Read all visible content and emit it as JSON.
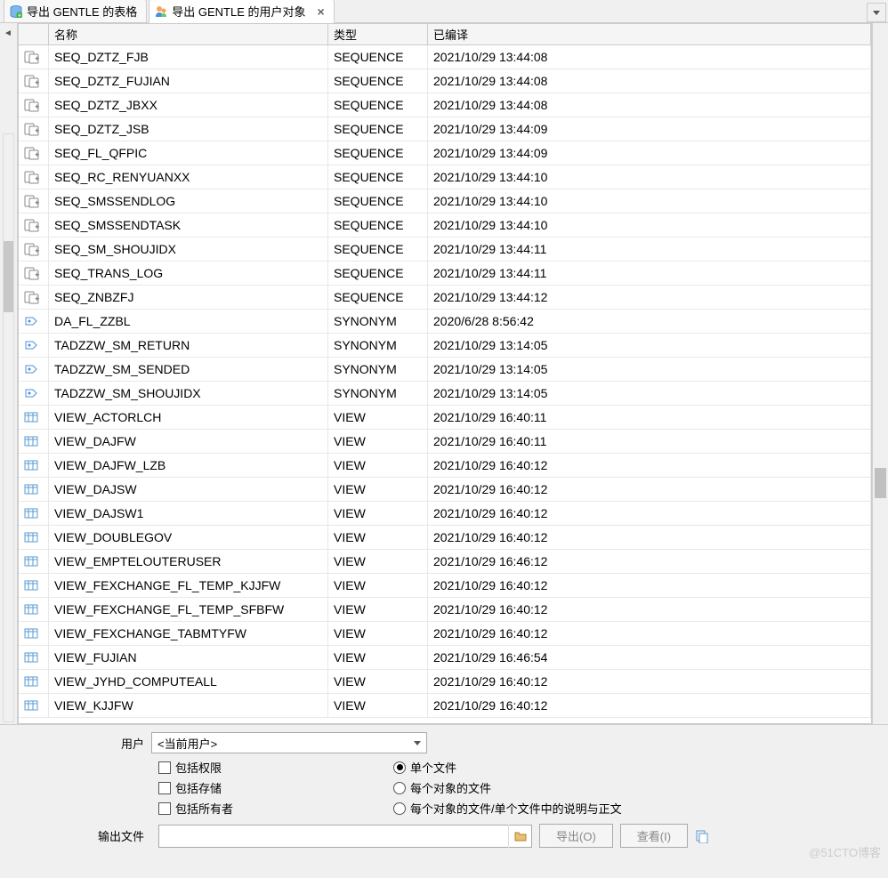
{
  "tabs": [
    {
      "label": "导出 GENTLE 的表格",
      "icon": "db"
    },
    {
      "label": "导出 GENTLE 的用户对象",
      "icon": "user",
      "active": true
    }
  ],
  "columns": {
    "name": "名称",
    "type": "类型",
    "compiled": "已编译"
  },
  "rows": [
    {
      "icon": "seq",
      "name": "SEQ_DZTZ_FJB",
      "type": "SEQUENCE",
      "compiled": "2021/10/29 13:44:08"
    },
    {
      "icon": "seq",
      "name": "SEQ_DZTZ_FUJIAN",
      "type": "SEQUENCE",
      "compiled": "2021/10/29 13:44:08"
    },
    {
      "icon": "seq",
      "name": "SEQ_DZTZ_JBXX",
      "type": "SEQUENCE",
      "compiled": "2021/10/29 13:44:08"
    },
    {
      "icon": "seq",
      "name": "SEQ_DZTZ_JSB",
      "type": "SEQUENCE",
      "compiled": "2021/10/29 13:44:09"
    },
    {
      "icon": "seq",
      "name": "SEQ_FL_QFPIC",
      "type": "SEQUENCE",
      "compiled": "2021/10/29 13:44:09"
    },
    {
      "icon": "seq",
      "name": "SEQ_RC_RENYUANXX",
      "type": "SEQUENCE",
      "compiled": "2021/10/29 13:44:10"
    },
    {
      "icon": "seq",
      "name": "SEQ_SMSSENDLOG",
      "type": "SEQUENCE",
      "compiled": "2021/10/29 13:44:10"
    },
    {
      "icon": "seq",
      "name": "SEQ_SMSSENDTASK",
      "type": "SEQUENCE",
      "compiled": "2021/10/29 13:44:10"
    },
    {
      "icon": "seq",
      "name": "SEQ_SM_SHOUJIDX",
      "type": "SEQUENCE",
      "compiled": "2021/10/29 13:44:11"
    },
    {
      "icon": "seq",
      "name": "SEQ_TRANS_LOG",
      "type": "SEQUENCE",
      "compiled": "2021/10/29 13:44:11"
    },
    {
      "icon": "seq",
      "name": "SEQ_ZNBZFJ",
      "type": "SEQUENCE",
      "compiled": "2021/10/29 13:44:12"
    },
    {
      "icon": "syn",
      "name": "DA_FL_ZZBL",
      "type": "SYNONYM",
      "compiled": "2020/6/28 8:56:42"
    },
    {
      "icon": "syn",
      "name": "TADZZW_SM_RETURN",
      "type": "SYNONYM",
      "compiled": "2021/10/29 13:14:05"
    },
    {
      "icon": "syn",
      "name": "TADZZW_SM_SENDED",
      "type": "SYNONYM",
      "compiled": "2021/10/29 13:14:05"
    },
    {
      "icon": "syn",
      "name": "TADZZW_SM_SHOUJIDX",
      "type": "SYNONYM",
      "compiled": "2021/10/29 13:14:05"
    },
    {
      "icon": "view",
      "name": "VIEW_ACTORLCH",
      "type": "VIEW",
      "compiled": "2021/10/29 16:40:11"
    },
    {
      "icon": "view",
      "name": "VIEW_DAJFW",
      "type": "VIEW",
      "compiled": "2021/10/29 16:40:11"
    },
    {
      "icon": "view",
      "name": "VIEW_DAJFW_LZB",
      "type": "VIEW",
      "compiled": "2021/10/29 16:40:12"
    },
    {
      "icon": "view",
      "name": "VIEW_DAJSW",
      "type": "VIEW",
      "compiled": "2021/10/29 16:40:12"
    },
    {
      "icon": "view",
      "name": "VIEW_DAJSW1",
      "type": "VIEW",
      "compiled": "2021/10/29 16:40:12"
    },
    {
      "icon": "view",
      "name": "VIEW_DOUBLEGOV",
      "type": "VIEW",
      "compiled": "2021/10/29 16:40:12"
    },
    {
      "icon": "view",
      "name": "VIEW_EMPTELOUTERUSER",
      "type": "VIEW",
      "compiled": "2021/10/29 16:46:12"
    },
    {
      "icon": "view",
      "name": "VIEW_FEXCHANGE_FL_TEMP_KJJFW",
      "type": "VIEW",
      "compiled": "2021/10/29 16:40:12"
    },
    {
      "icon": "view",
      "name": "VIEW_FEXCHANGE_FL_TEMP_SFBFW",
      "type": "VIEW",
      "compiled": "2021/10/29 16:40:12"
    },
    {
      "icon": "view",
      "name": "VIEW_FEXCHANGE_TABMTYFW",
      "type": "VIEW",
      "compiled": "2021/10/29 16:40:12"
    },
    {
      "icon": "view",
      "name": "VIEW_FUJIAN",
      "type": "VIEW",
      "compiled": "2021/10/29 16:46:54"
    },
    {
      "icon": "view",
      "name": "VIEW_JYHD_COMPUTEALL",
      "type": "VIEW",
      "compiled": "2021/10/29 16:40:12"
    },
    {
      "icon": "view",
      "name": "VIEW_KJJFW",
      "type": "VIEW",
      "compiled": "2021/10/29 16:40:12"
    }
  ],
  "form": {
    "user_label": "用户",
    "user_value": "<当前用户>",
    "chk_priv": "包括权限",
    "chk_storage": "包括存储",
    "chk_owner": "包括所有者",
    "radio_single": "单个文件",
    "radio_perobj": "每个对象的文件",
    "radio_perobj_desc": "每个对象的文件/单个文件中的说明与正文",
    "output_label": "输出文件",
    "export_btn": "导出(O)",
    "view_btn": "查看(I)"
  },
  "watermark": "@51CTO博客"
}
